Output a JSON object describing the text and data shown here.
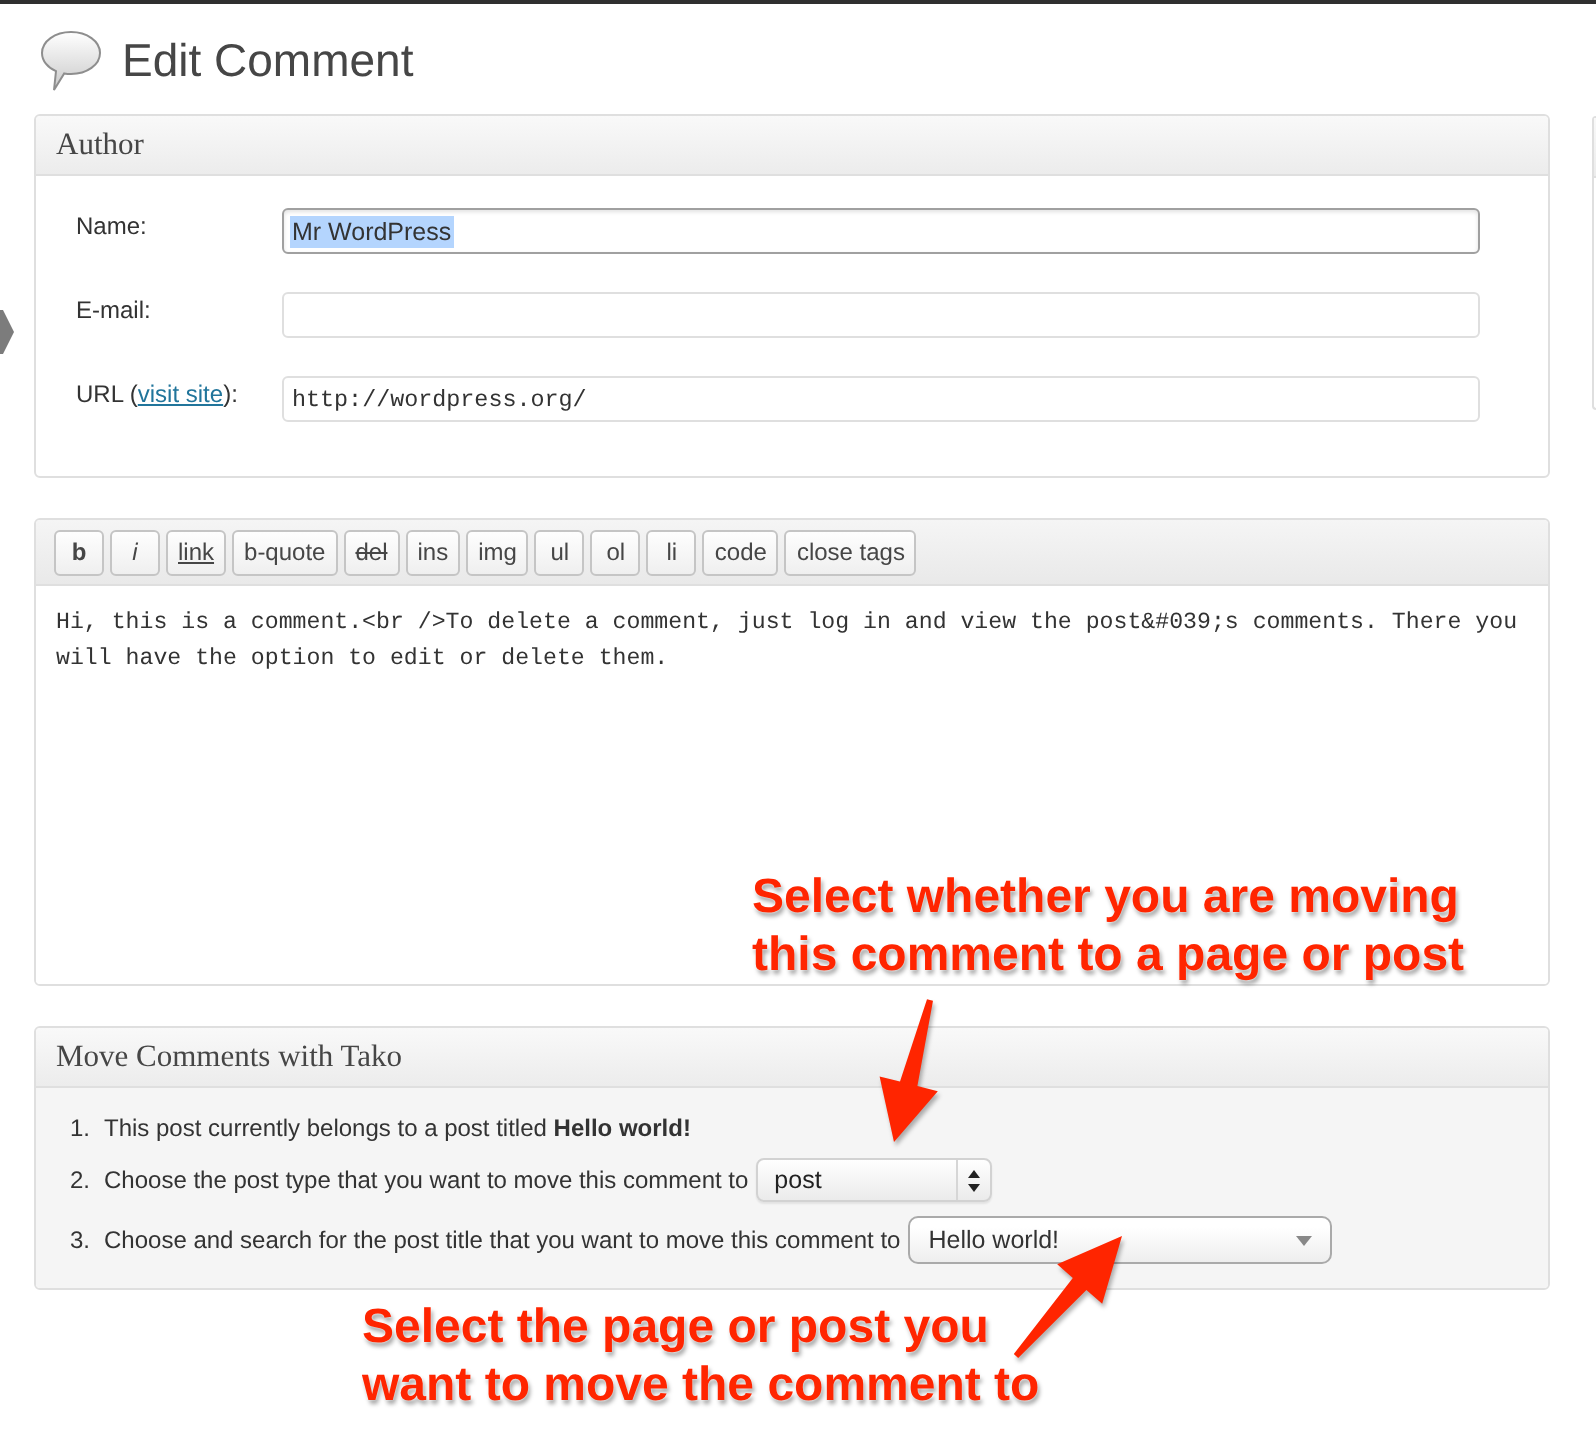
{
  "page": {
    "title": "Edit Comment"
  },
  "author_panel": {
    "title": "Author",
    "fields": [
      {
        "kind": "text",
        "label": "Name:",
        "value": "Mr WordPress",
        "focused": true
      },
      {
        "kind": "text",
        "label": "E-mail:",
        "focused": false
      },
      {
        "kind": "url",
        "label_start": "URL (",
        "link": "visit site",
        "label_end": "):",
        "value": "http://wordpress.org/",
        "focused": false
      }
    ]
  },
  "editor": {
    "buttons": [
      {
        "label": "b",
        "kind": "bold"
      },
      {
        "label": "i",
        "kind": "italic"
      },
      {
        "label": "link",
        "kind": "underline"
      },
      {
        "label": "b-quote",
        "kind": "plain"
      },
      {
        "label": "del",
        "kind": "strike"
      },
      {
        "label": "ins",
        "kind": "plain"
      },
      {
        "label": "img",
        "kind": "plain"
      },
      {
        "label": "ul",
        "kind": "plain"
      },
      {
        "label": "ol",
        "kind": "plain"
      },
      {
        "label": "li",
        "kind": "plain"
      },
      {
        "label": "code",
        "kind": "plain"
      },
      {
        "label": "close tags",
        "kind": "plain"
      }
    ],
    "content": "Hi, this is a comment.<br />To delete a comment, just log in and view the post&#039;s comments. There you will have the option to edit or delete them."
  },
  "move_panel": {
    "title": "Move Comments with Tako",
    "steps": [
      {
        "number": "1.",
        "text": "This post currently belongs to a post titled **Hello world!**"
      },
      {
        "number": "2.",
        "text": "Choose the post type that you want to move this comment to",
        "select": {
          "kind": "native",
          "value": "post"
        }
      },
      {
        "number": "3.",
        "text": "Choose and search for the post title that you want to move this comment to",
        "select": {
          "kind": "search",
          "value": "Hello world!"
        }
      }
    ]
  },
  "annotations": [
    {
      "lines": [
        "Select whether you are moving",
        "this comment to a page or post"
      ]
    },
    {
      "lines": [
        "Select the page or post you",
        "want to move the comment to"
      ]
    }
  ]
}
